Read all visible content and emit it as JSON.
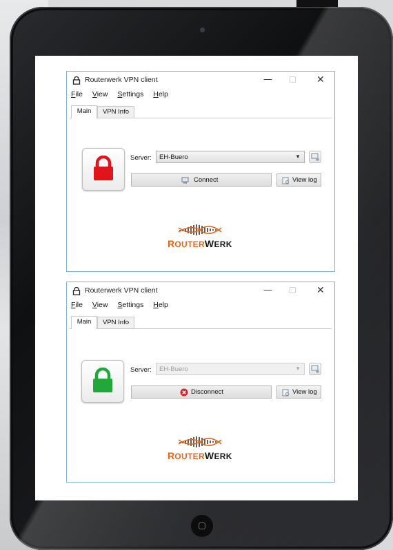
{
  "windows": [
    {
      "title": "Routerwerk VPN client",
      "menu": [
        {
          "accel": "F",
          "rest": "ile"
        },
        {
          "accel": "V",
          "rest": "iew"
        },
        {
          "accel": "S",
          "rest": "ettings"
        },
        {
          "accel": "H",
          "rest": "elp"
        }
      ],
      "tabs": [
        "Main",
        "VPN Info"
      ],
      "active_tab": "Main",
      "state": "locked",
      "lock_color": "#e0141b",
      "server_label": "Server:",
      "server_value": "EH-Buero",
      "server_enabled": true,
      "action_label": "Connect",
      "action_icon": "connect-icon",
      "view_log_label": "View log",
      "logo": {
        "part1_letter": "R",
        "part1_rest": "OUTER",
        "part2_letter": "W",
        "part2_rest": "ERK"
      }
    },
    {
      "title": "Routerwerk VPN client",
      "menu": [
        {
          "accel": "F",
          "rest": "ile"
        },
        {
          "accel": "V",
          "rest": "iew"
        },
        {
          "accel": "S",
          "rest": "ettings"
        },
        {
          "accel": "H",
          "rest": "elp"
        }
      ],
      "tabs": [
        "Main",
        "VPN Info"
      ],
      "active_tab": "Main",
      "state": "unlocked",
      "lock_color": "#22a83a",
      "server_label": "Server:",
      "server_value": "EH-Buero",
      "server_enabled": false,
      "action_label": "Disconnect",
      "action_icon": "disconnect-icon",
      "view_log_label": "View log",
      "logo": {
        "part1_letter": "R",
        "part1_rest": "OUTER",
        "part2_letter": "W",
        "part2_rest": "ERK"
      }
    }
  ],
  "colors": {
    "accent_border": "#7fb2e3",
    "logo_orange": "#e2661a"
  }
}
